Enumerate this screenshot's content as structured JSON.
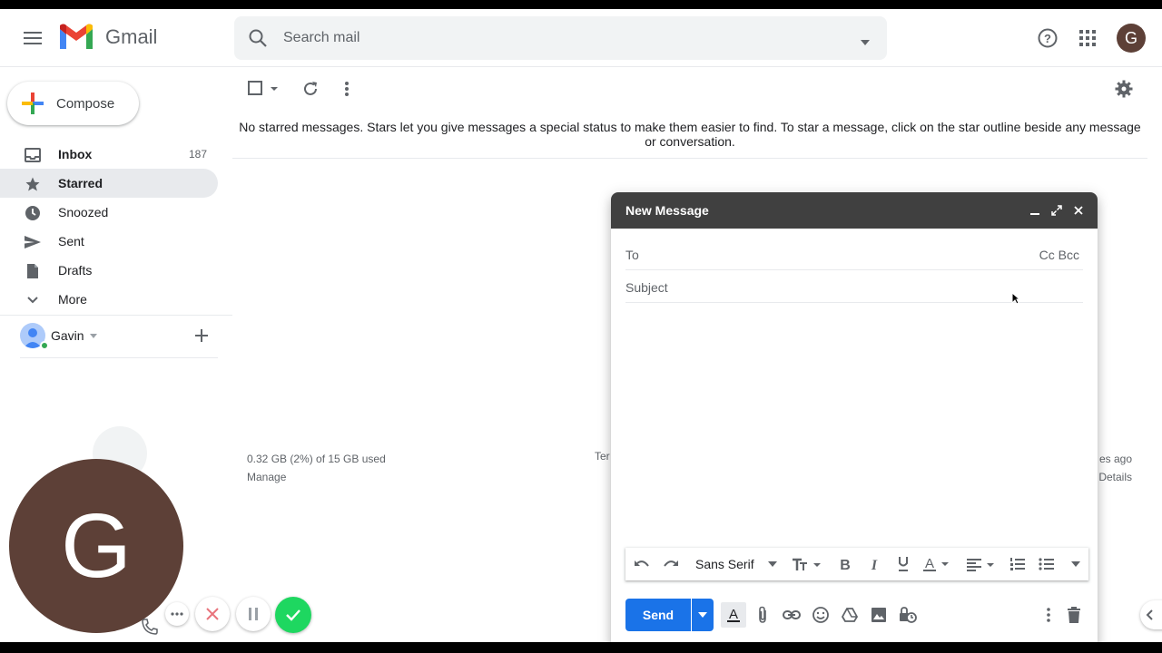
{
  "header": {
    "app_name": "Gmail",
    "search_placeholder": "Search mail",
    "avatar_letter": "G"
  },
  "sidebar": {
    "compose_label": "Compose",
    "items": [
      {
        "label": "Inbox",
        "count": "187",
        "icon": "inbox-icon",
        "active": false
      },
      {
        "label": "Starred",
        "count": "",
        "icon": "star-icon",
        "active": true
      },
      {
        "label": "Snoozed",
        "count": "",
        "icon": "clock-icon",
        "active": false
      },
      {
        "label": "Sent",
        "count": "",
        "icon": "send-icon",
        "active": false
      },
      {
        "label": "Drafts",
        "count": "",
        "icon": "draft-icon",
        "active": false
      },
      {
        "label": "More",
        "count": "",
        "icon": "chevron-down-icon",
        "active": false
      }
    ],
    "hangouts_user": "Gavin"
  },
  "main": {
    "empty_message": "No starred messages. Stars let you give messages a special status to make them easier to find. To star a message, click on the star outline beside any message or conversation.",
    "storage": "0.32 GB (2%) of 15 GB used",
    "manage_link": "Manage",
    "footer_mid_fragment": "Ter",
    "footer_right_line1": "es ago",
    "footer_right_line2": "Details"
  },
  "compose_window": {
    "title": "New Message",
    "to_label": "To",
    "cc_bcc": "Cc Bcc",
    "subject_placeholder": "Subject",
    "font_name": "Sans Serif",
    "send_label": "Send"
  },
  "call_overlay": {
    "avatar_letter": "G"
  },
  "colors": {
    "accent": "#1a73e8",
    "compose_header": "#404040",
    "avatar": "#5d4037",
    "accept_green": "#1ed760",
    "decline_red": "#d93025"
  }
}
